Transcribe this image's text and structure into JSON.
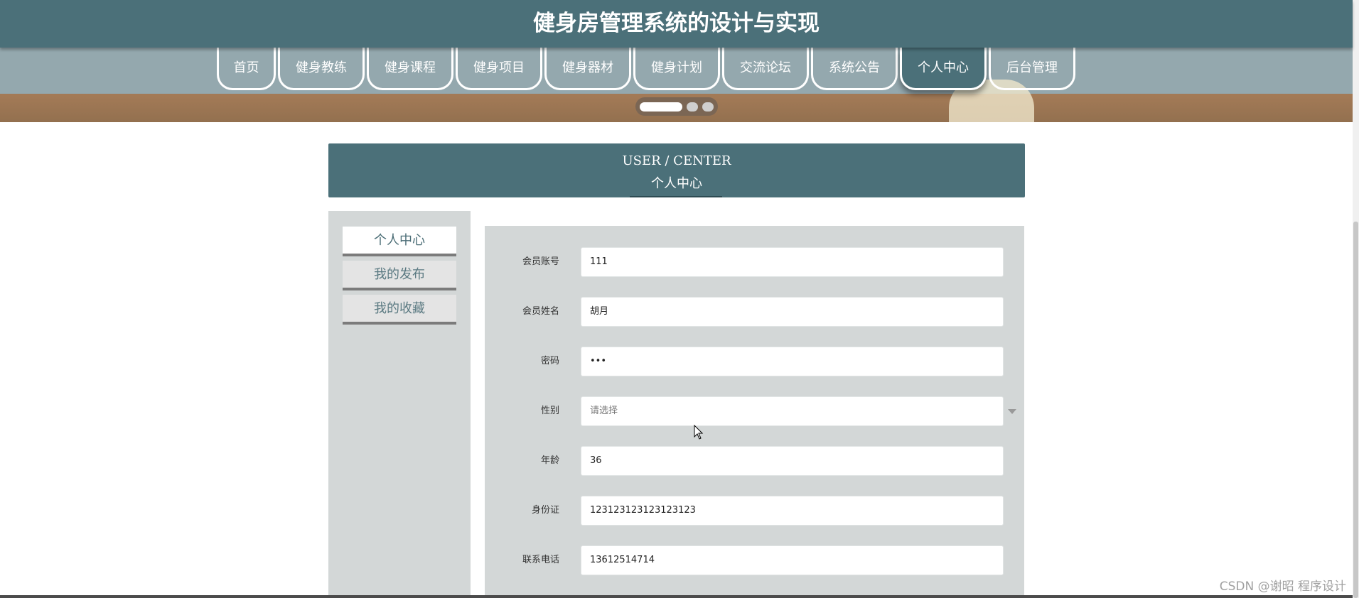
{
  "header": {
    "title": "健身房管理系统的设计与实现"
  },
  "nav": {
    "items": [
      {
        "label": "首页",
        "w": 83,
        "active": false
      },
      {
        "label": "健身教练",
        "w": 122,
        "active": false
      },
      {
        "label": "健身课程",
        "w": 122,
        "active": false
      },
      {
        "label": "健身项目",
        "w": 122,
        "active": false
      },
      {
        "label": "健身器材",
        "w": 122,
        "active": false
      },
      {
        "label": "健身计划",
        "w": 122,
        "active": false
      },
      {
        "label": "交流论坛",
        "w": 122,
        "active": false
      },
      {
        "label": "系统公告",
        "w": 122,
        "active": false
      },
      {
        "label": "个人中心",
        "w": 122,
        "active": true
      },
      {
        "label": "后台管理",
        "w": 122,
        "active": false
      }
    ]
  },
  "section": {
    "title_en": "USER / CENTER",
    "title_cn": "个人中心"
  },
  "sidebar": {
    "items": [
      {
        "label": "个人中心",
        "active": true
      },
      {
        "label": "我的发布",
        "active": false
      },
      {
        "label": "我的收藏",
        "active": false
      }
    ]
  },
  "form": {
    "fields": [
      {
        "label": "会员账号",
        "value": "111"
      },
      {
        "label": "会员姓名",
        "value": "胡月"
      },
      {
        "label": "密码",
        "value": "•••"
      },
      {
        "label": "性别",
        "value": "请选择"
      },
      {
        "label": "年龄",
        "value": "36"
      },
      {
        "label": "身份证",
        "value": "123123123123123123"
      },
      {
        "label": "联系电话",
        "value": "13612514714"
      }
    ]
  },
  "watermark": "CSDN @谢昭  程序设计"
}
